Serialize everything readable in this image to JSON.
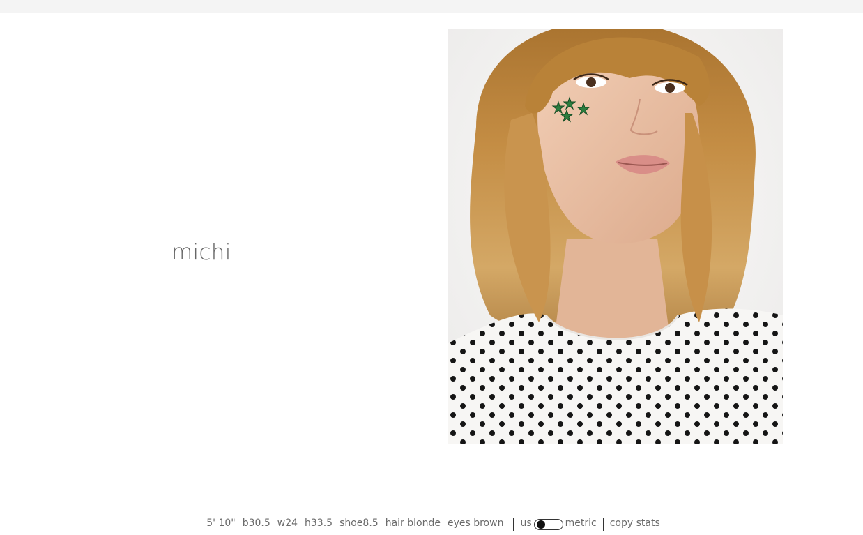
{
  "model": {
    "name": "michi"
  },
  "photo": {
    "alt": "michi"
  },
  "stats": {
    "height": "5' 10\"",
    "bust": "b30.5",
    "waist": "w24",
    "hips": "h33.5",
    "shoe": "shoe8.5",
    "hair": "hair blonde",
    "eyes": "eyes brown"
  },
  "units": {
    "us_label": "us",
    "metric_label": "metric",
    "selected": "us"
  },
  "actions": {
    "copy_label": "copy stats"
  },
  "colors": {
    "topbar": "#f4f4f4",
    "text": "#6a6a6a",
    "toggle_knob": "#111111"
  }
}
